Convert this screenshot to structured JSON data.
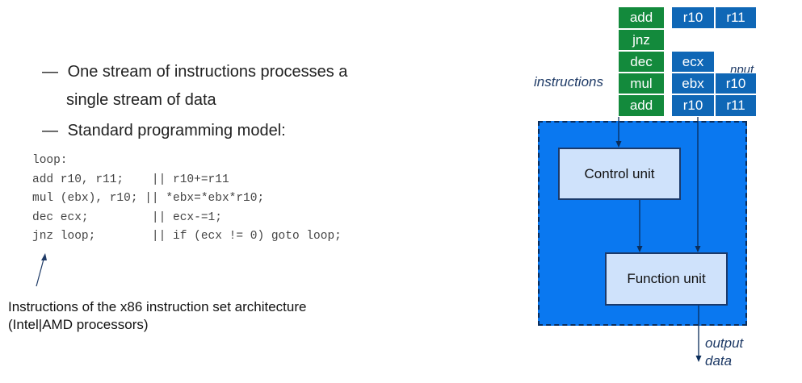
{
  "bullets": [
    {
      "dash": "—",
      "text": "One stream of instructions processes a"
    },
    {
      "text": "single stream of data"
    },
    {
      "dash": "—",
      "text": "Standard programming model:"
    }
  ],
  "code_lines": [
    "loop:",
    "add r10, r11;    || r10+=r11",
    "mul (ebx), r10; || *ebx=*ebx*r10;",
    "dec ecx;         || ecx-=1;",
    "jnz loop;        || if (ecx != 0) goto loop;"
  ],
  "note": {
    "line1": "Instructions of the x86 instruction set architecture",
    "line2": "(Intel|AMD processors)"
  },
  "diagram": {
    "instructions": [
      "add",
      "jnz",
      "dec",
      "mul",
      "add"
    ],
    "instructions_label": "instructions",
    "input_rows": [
      [
        "r10",
        "r11"
      ],
      [],
      [
        "ecx"
      ],
      [
        "ebx",
        "r10"
      ],
      [
        "r10",
        "r11"
      ]
    ],
    "input_label_fragment": "nput",
    "control_unit": "Control unit",
    "function_unit": "Function unit",
    "output_label_1": "output",
    "output_label_2": "data"
  },
  "colors": {
    "instruction_green": "#138a3c",
    "data_blue": "#0f67b6",
    "processor_blue": "#0a78f0",
    "unit_fill": "#cfe2fb"
  }
}
